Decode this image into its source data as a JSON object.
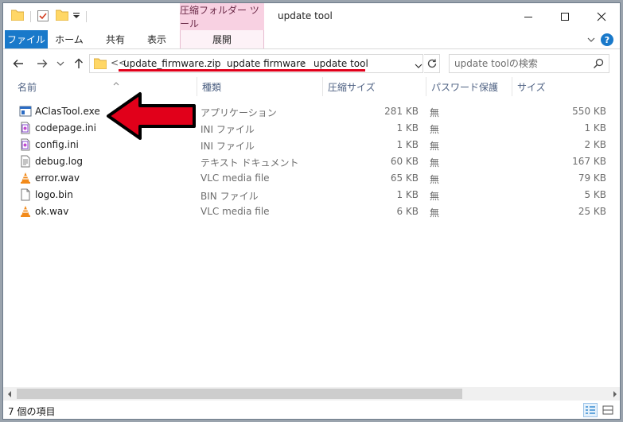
{
  "titlebar": {
    "context_tab_title": "圧縮フォルダー ツール",
    "window_title": "update tool"
  },
  "ribbon": {
    "tabs": [
      "ファイル",
      "ホーム",
      "共有",
      "表示",
      "展開"
    ],
    "help": "?"
  },
  "address": {
    "overflow": "<<",
    "breadcrumbs": [
      "update_firmware.zip",
      "update firmware",
      "update tool"
    ],
    "separator": "›",
    "search_placeholder": "update toolの検索"
  },
  "columns": {
    "name": "名前",
    "type": "種類",
    "compressed_size": "圧縮サイズ",
    "password": "パスワード保護",
    "size": "サイズ"
  },
  "files": [
    {
      "name": "AClasTool.exe",
      "type": "アプリケーション",
      "compressed_size": "281 KB",
      "password": "無",
      "size": "550 KB",
      "icon": "exe-icon"
    },
    {
      "name": "codepage.ini",
      "type": "INI ファイル",
      "compressed_size": "1 KB",
      "password": "無",
      "size": "1 KB",
      "icon": "ini-file-icon"
    },
    {
      "name": "config.ini",
      "type": "INI ファイル",
      "compressed_size": "1 KB",
      "password": "無",
      "size": "2 KB",
      "icon": "ini-file-icon"
    },
    {
      "name": "debug.log",
      "type": "テキスト ドキュメント",
      "compressed_size": "60 KB",
      "password": "無",
      "size": "167 KB",
      "icon": "text-file-icon"
    },
    {
      "name": "error.wav",
      "type": "VLC media file",
      "compressed_size": "65 KB",
      "password": "無",
      "size": "79 KB",
      "icon": "vlc-icon"
    },
    {
      "name": "logo.bin",
      "type": "BIN ファイル",
      "compressed_size": "1 KB",
      "password": "無",
      "size": "5 KB",
      "icon": "blank-file-icon"
    },
    {
      "name": "ok.wav",
      "type": "VLC media file",
      "compressed_size": "6 KB",
      "password": "無",
      "size": "25 KB",
      "icon": "vlc-icon"
    }
  ],
  "status": {
    "item_count": "7 個の項目"
  },
  "colors": {
    "accent": "#1979ca",
    "context_tab": "#f8d1e2",
    "annotation_red": "#e1001a",
    "folder": "#ffd766"
  }
}
